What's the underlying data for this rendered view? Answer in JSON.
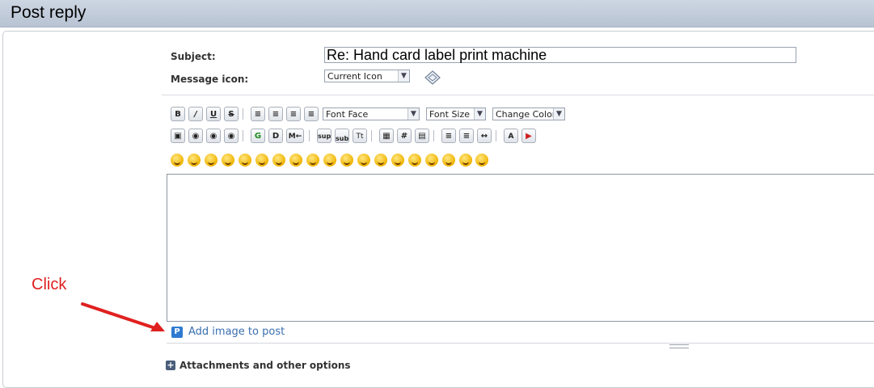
{
  "header": {
    "title": "Post reply"
  },
  "form": {
    "subject_label": "Subject:",
    "subject_value": "Re: Hand card label print machine",
    "icon_label": "Message icon:",
    "icon_select_value": "Current Icon"
  },
  "toolbar": {
    "row1": [
      "B",
      "I",
      "U",
      "S"
    ],
    "align": [
      "left",
      "center-left",
      "center",
      "right"
    ],
    "font_face": "Font Face",
    "font_size": "Font Size",
    "change_color": "Change Color",
    "row2_a": [
      "image",
      "link",
      "unlink",
      "email"
    ],
    "row2_b": [
      "G",
      "D",
      "M←"
    ],
    "row2_c": [
      "sup",
      "sub",
      "Tt"
    ],
    "row2_d": [
      "table",
      "#",
      "quote"
    ],
    "row2_e": [
      "bullets",
      "numbers",
      "hr"
    ],
    "row2_f": [
      "spell",
      "source"
    ],
    "smileys_count": 19
  },
  "attachments": {
    "add_image_label": "Add image to post",
    "more_label": "Attachments and other options"
  },
  "annotation": {
    "click_label": "Click",
    "color": "#e02020"
  }
}
